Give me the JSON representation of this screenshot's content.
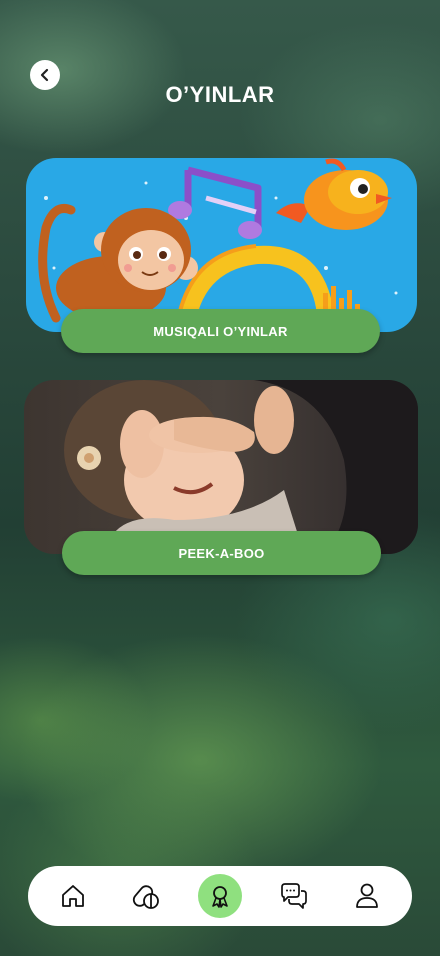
{
  "header": {
    "title": "O’YINLAR",
    "back_icon": "chevron-left-icon"
  },
  "cards": [
    {
      "label": "MUSIQALI O’YINLAR",
      "image": "cartoon-monkey-bird-music-illustration"
    },
    {
      "label": "PEEK-A-BOO",
      "image": "photo-child-hands-over-eyes"
    }
  ],
  "bottom_nav": {
    "items": [
      {
        "icon": "home-icon",
        "active": false
      },
      {
        "icon": "pills-icon",
        "active": false
      },
      {
        "icon": "award-ribbon-icon",
        "active": true
      },
      {
        "icon": "chat-bubbles-icon",
        "active": false
      },
      {
        "icon": "user-icon",
        "active": false
      }
    ]
  },
  "colors": {
    "accent_green": "#5fa856",
    "active_nav_bg": "#8fe07f",
    "card1_sky": "#29a8e6",
    "title_text": "#ffffff"
  }
}
